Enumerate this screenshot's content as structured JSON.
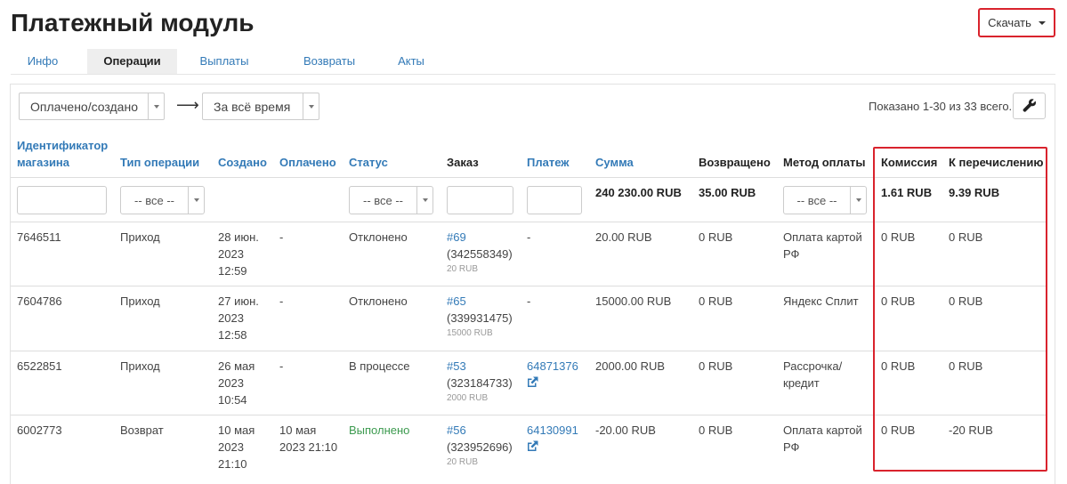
{
  "page": {
    "title": "Платежный модуль",
    "download_label": "Скачать"
  },
  "tabs": [
    {
      "label": "Инфо",
      "active": false
    },
    {
      "label": "Операции",
      "active": true
    },
    {
      "label": "Выплаты",
      "active": false
    },
    {
      "label": "Возвраты",
      "active": false
    },
    {
      "label": "Акты",
      "active": false
    }
  ],
  "toolbar": {
    "date_type": "Оплачено/создано",
    "arrow": "⟶",
    "period": "За всё время",
    "shown_text": "Показано 1-30 из 33 всего."
  },
  "columns": {
    "shop_id": "Идентификатор магазина",
    "op_type": "Тип операции",
    "created": "Создано",
    "paid": "Оплачено",
    "status": "Статус",
    "order": "Заказ",
    "payment": "Платеж",
    "amount": "Сумма",
    "refunded": "Возвращено",
    "method": "Метод оплаты",
    "commission": "Комиссия",
    "transfer": "К перечислению"
  },
  "filters": {
    "op_type": "-- все --",
    "status": "-- все --",
    "method": "-- все --"
  },
  "totals": {
    "amount": "240 230.00 RUB",
    "refunded": "35.00 RUB",
    "commission": "1.61 RUB",
    "transfer": "9.39 RUB"
  },
  "rows": [
    {
      "shop_id": "7646511",
      "op_type": "Приход",
      "created": [
        "28 июн.",
        "2023",
        "12:59"
      ],
      "paid": "-",
      "status": "Отклонено",
      "status_color": "#444444",
      "order_link": "#69",
      "order_id": "(342558349)",
      "order_sum": "20 RUB",
      "payment": "-",
      "payment_is_link": false,
      "amount": "20.00 RUB",
      "refunded": "0 RUB",
      "method": [
        "Оплата картой",
        "РФ"
      ],
      "commission": "0 RUB",
      "transfer": "0 RUB"
    },
    {
      "shop_id": "7604786",
      "op_type": "Приход",
      "created": [
        "27 июн.",
        "2023",
        "12:58"
      ],
      "paid": "-",
      "status": "Отклонено",
      "status_color": "#444444",
      "order_link": "#65",
      "order_id": "(339931475)",
      "order_sum": "15000 RUB",
      "payment": "-",
      "payment_is_link": false,
      "amount": "15000.00 RUB",
      "refunded": "0 RUB",
      "method": [
        "Яндекс Сплит",
        ""
      ],
      "commission": "0 RUB",
      "transfer": "0 RUB"
    },
    {
      "shop_id": "6522851",
      "op_type": "Приход",
      "created": [
        "26 мая",
        "2023",
        "10:54"
      ],
      "paid": "-",
      "status": "В процессе",
      "status_color": "#444444",
      "order_link": "#53",
      "order_id": "(323184733)",
      "order_sum": "2000 RUB",
      "payment": "64871376",
      "payment_is_link": true,
      "amount": "2000.00 RUB",
      "refunded": "0 RUB",
      "method": [
        "Рассрочка/",
        "кредит"
      ],
      "commission": "0 RUB",
      "transfer": "0 RUB"
    },
    {
      "shop_id": "6002773",
      "op_type": "Возврат",
      "created": [
        "10 мая",
        "2023",
        "21:10"
      ],
      "paid": "10 мая 2023 21:10",
      "status": "Выполнено",
      "status_color": "#3c9a4f",
      "order_link": "#56",
      "order_id": "(323952696)",
      "order_sum": "20 RUB",
      "payment": "64130991",
      "payment_is_link": true,
      "amount": "-20.00 RUB",
      "refunded": "0 RUB",
      "method": [
        "Оплата картой",
        "РФ"
      ],
      "commission": "0 RUB",
      "transfer": "-20 RUB"
    }
  ],
  "colors": {
    "accent": "#337ab7",
    "highlight": "#d9232d",
    "success": "#3c9a4f"
  }
}
